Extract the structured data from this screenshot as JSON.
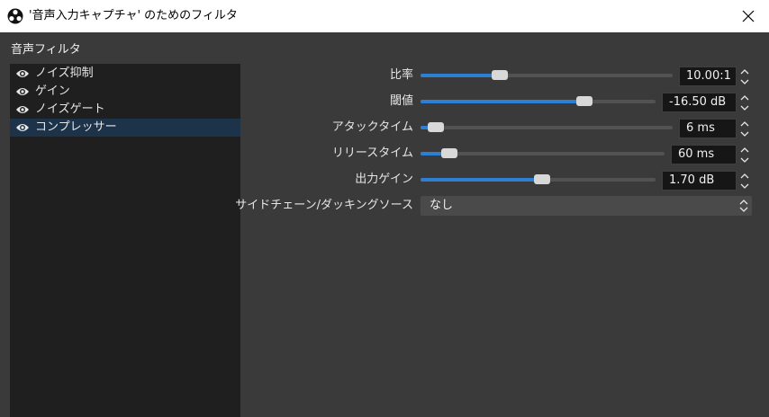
{
  "window": {
    "title": "'音声入力キャプチャ' のためのフィルタ",
    "logo_icon": "obs-logo-icon",
    "close_icon": "close-icon"
  },
  "panel": {
    "section_label": "音声フィルタ"
  },
  "filters": [
    {
      "label": "ノイズ抑制",
      "icon": "eye-icon",
      "selected": false
    },
    {
      "label": "ゲイン",
      "icon": "eye-icon",
      "selected": false
    },
    {
      "label": "ノイズゲート",
      "icon": "eye-icon",
      "selected": false
    },
    {
      "label": "コンプレッサー",
      "icon": "eye-icon",
      "selected": true
    }
  ],
  "properties": {
    "ratio": {
      "label": "比率",
      "value": "10.00:1",
      "level": 0.3
    },
    "threshold": {
      "label": "閾値",
      "value": "-16.50 dB",
      "level": 0.71
    },
    "attack": {
      "label": "アタックタイム",
      "value": "6 ms",
      "level": 0.03
    },
    "release": {
      "label": "リリースタイム",
      "value": "60 ms",
      "level": 0.09
    },
    "output_gain": {
      "label": "出力ゲイン",
      "value": "1.70 dB",
      "level": 0.52
    },
    "sidechain": {
      "label": "サイドチェーン/ダッキングソース",
      "value": "なし"
    }
  },
  "colors": {
    "accent": "#2d7fd4",
    "selected_row": "#1d3349",
    "panel_bg": "#3a3a3a",
    "list_bg": "#1f1f1f"
  }
}
